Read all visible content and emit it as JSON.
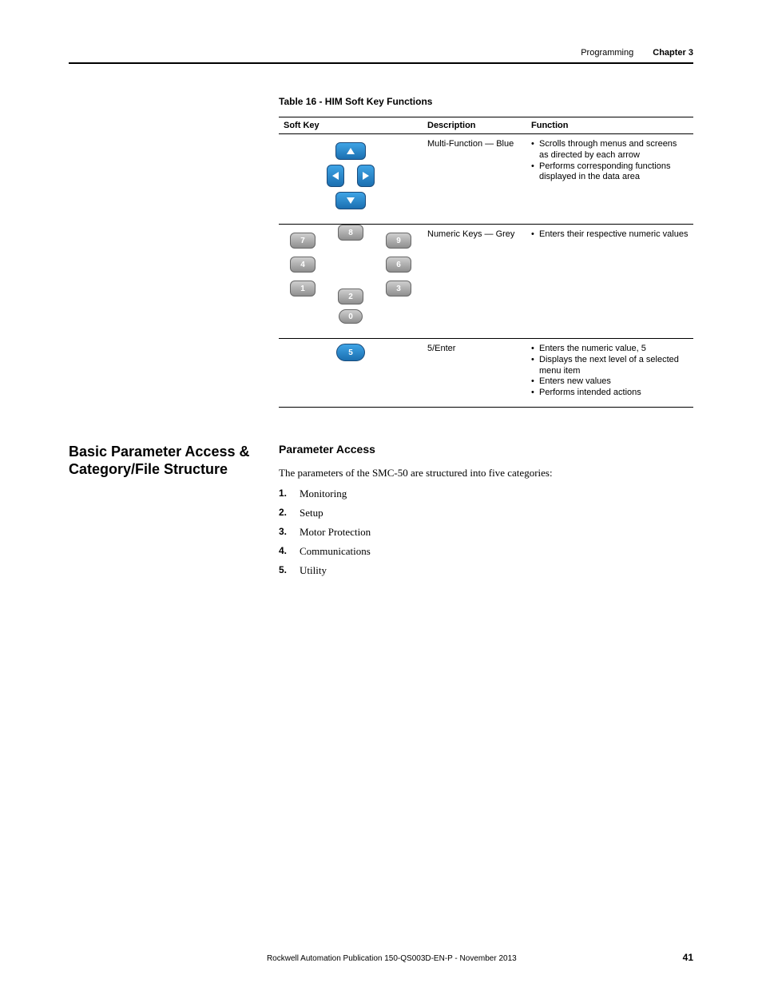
{
  "header": {
    "section": "Programming",
    "chapter": "Chapter 3"
  },
  "table": {
    "title": "Table 16 - HIM Soft Key Functions",
    "columns": [
      "Soft Key",
      "Description",
      "Function"
    ],
    "rows": [
      {
        "description": "Multi-Function — Blue",
        "functions": [
          "Scrolls through menus and screens as directed by each arrow",
          "Performs corresponding functions displayed in the data area"
        ]
      },
      {
        "description": "Numeric Keys — Grey",
        "numkeys": [
          "7",
          "8",
          "9",
          "4",
          "6",
          "1",
          "3",
          "2",
          "0"
        ],
        "functions": [
          "Enters their respective numeric values"
        ]
      },
      {
        "description": "5/Enter",
        "enterkey": "5",
        "functions": [
          "Enters the numeric value, 5",
          "Displays the next level of a selected menu item",
          "Enters new values",
          "Performs intended actions"
        ]
      }
    ]
  },
  "section": {
    "heading": "Basic Parameter Access & Category/File Structure",
    "subheading": "Parameter Access",
    "intro": "The parameters of the SMC-50 are structured into five categories:",
    "categories": [
      "Monitoring",
      "Setup",
      "Motor Protection",
      "Communications",
      "Utility"
    ]
  },
  "footer": {
    "publication": "Rockwell Automation Publication  150-QS003D-EN-P - November 2013",
    "page": "41"
  }
}
